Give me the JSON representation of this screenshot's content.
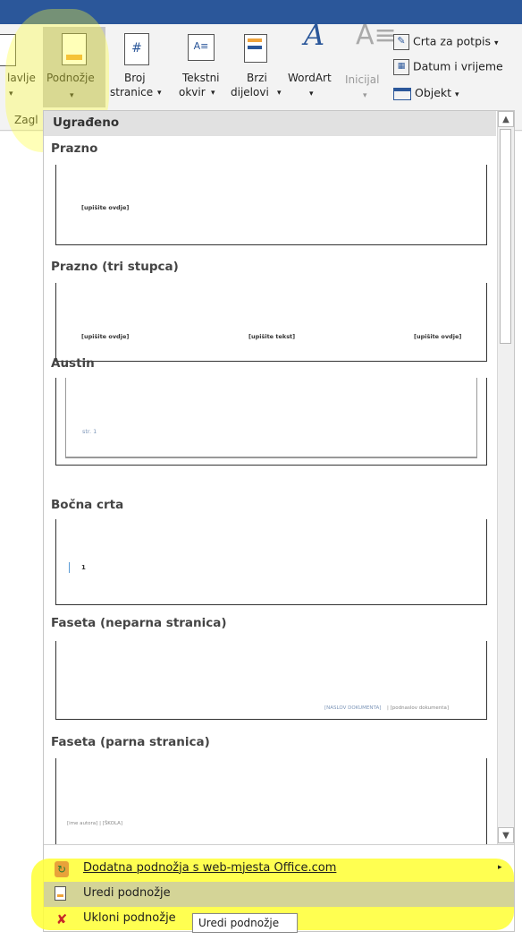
{
  "ribbon": {
    "header_btn": "lavlje",
    "footer_btn": "Podnožje",
    "page_number_line1": "Broj",
    "page_number_line2": "stranice",
    "textbox_line1": "Tekstni",
    "textbox_line2": "okvir",
    "quickparts_line1": "Brzi",
    "quickparts_line2": "dijelovi",
    "wordart": "WordArt",
    "dropcap": "Inicijal",
    "signature_line": "Crta za potpis",
    "date_time": "Datum i vrijeme",
    "object": "Objekt",
    "group_label": "Zagl",
    "page_number_icon": "#"
  },
  "dropdown": {
    "section_header": "Ugrađeno",
    "items": [
      {
        "title": "Prazno",
        "placeholders": [
          "[upišite ovdje]"
        ]
      },
      {
        "title": "Prazno (tri stupca)",
        "placeholders": [
          "[upišite ovdje]",
          "[upišite tekst]",
          "[upišite ovdje]"
        ]
      },
      {
        "title": "Austin",
        "placeholders": [
          "str. 1"
        ]
      },
      {
        "title": "Bočna crta",
        "placeholders": [
          "1"
        ]
      },
      {
        "title": "Faseta (neparna stranica)",
        "placeholders": [
          "[NASLOV DOKUMENTA]",
          "| [podnaslov dokumenta]"
        ]
      },
      {
        "title": "Faseta (parna stranica)",
        "placeholders": [
          "[ime autora] | [ŠKOLA]"
        ]
      }
    ],
    "menu": {
      "more_footers": "Dodatna podnožja s web-mjesta Office.com",
      "edit_footer": "Uredi podnožje",
      "remove_footer": "Ukloni podnožje"
    },
    "tooltip": "Uredi podnožje"
  },
  "colors": {
    "title_bar": "#2b579a",
    "highlight": "#ffff33",
    "selected": "#c5c5c5",
    "footer_bar": "#f0a33a"
  }
}
